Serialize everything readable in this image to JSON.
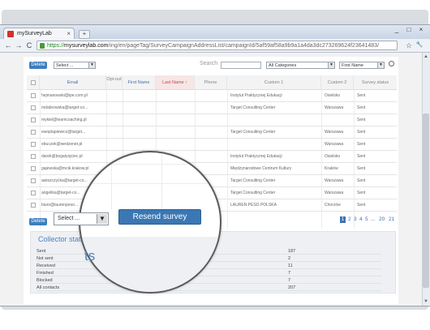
{
  "browser": {
    "tab_title": "mySurveyLab",
    "tab_close": "×",
    "new_tab": "+",
    "window_controls": [
      "_",
      "□",
      "×"
    ],
    "nav": {
      "back": "←",
      "forward": "→",
      "reload": "C"
    },
    "url": {
      "scheme": "https://",
      "host": "mysurveylab.com",
      "path": "/ing/en/pageTag/SurveyCampaignAddressList/campaignId/5af59af58a9b9a1a4da3dc273269624f23641483/"
    },
    "star_icon": "☆",
    "wrench_icon": "🔧"
  },
  "toolbar": {
    "delete_label": "Delete",
    "action_select": "Select ...",
    "search_label": "Search",
    "category_select": "All Categories",
    "field_select": "First Name"
  },
  "table": {
    "headers": [
      "Email",
      "Opt-out",
      "First Name",
      "Last Name ↑",
      "Phone",
      "Custom 1",
      "Custom 2",
      "Survey status"
    ],
    "rows": [
      {
        "email": "hejmanowski@ipe.com.pl",
        "custom1": "Instytut Praktycznej Edukacji",
        "custom2": "Osielsko",
        "status": "Sent"
      },
      {
        "email": "mdabrowska@target-co...",
        "custom1": "Target Consulting Center",
        "custom2": "Warszawa",
        "status": "Sent"
      },
      {
        "email": "mykiel@teamcoaching.pl",
        "custom1": "",
        "custom2": "",
        "status": "Sent"
      },
      {
        "email": "ewoplapiewicz@target...",
        "custom1": "Target Consulting Center",
        "custom2": "Warszawa",
        "status": "Sent"
      },
      {
        "email": "ebuczek@wedzenet.pl",
        "custom1": "",
        "custom2": "Warszawa",
        "status": "Sent"
      },
      {
        "email": "darek@bogatyojciec.pl",
        "custom1": "Instytut Praktycznej Edukacji",
        "custom2": "Osielsko",
        "status": "Sent"
      },
      {
        "email": "gajewska@mcik.krakow.pl",
        "custom1": "Międzynarodowe Centrum Kultury",
        "custom2": "Kraków",
        "status": "Sent"
      },
      {
        "email": "awiszczycka@target-co...",
        "custom1": "Target Consulting Center",
        "custom2": "Warszawa",
        "status": "Sent"
      },
      {
        "email": "angelika@target-co...",
        "custom1": "Target Consulting Center",
        "custom2": "Warszawa",
        "status": "Sent"
      },
      {
        "email": "biuro@laurenpeso...",
        "custom1": "LAUREN PESO POLSKA",
        "custom2": "Chorzów",
        "status": "Sent"
      }
    ]
  },
  "bottom": {
    "delete_label": "Delete",
    "action_select": "Select ...",
    "resend_label": "Resend survey"
  },
  "pagination": {
    "current": "1",
    "pages": [
      "2",
      "3",
      "4",
      "5",
      "...",
      "20",
      "21"
    ]
  },
  "stats": {
    "title": "Collector stats",
    "magnified_fragment": "ts",
    "rows": [
      {
        "label": "Sent",
        "value": "187"
      },
      {
        "label": "Not sent",
        "value": "2"
      },
      {
        "label": "Received",
        "value": "11"
      },
      {
        "label": "Finished",
        "value": "7"
      },
      {
        "label": "Blocked",
        "value": "7"
      },
      {
        "label": "All contacts",
        "value": "207"
      }
    ]
  }
}
